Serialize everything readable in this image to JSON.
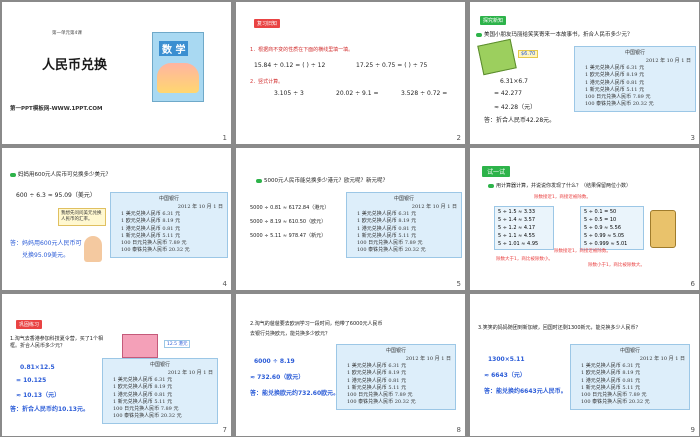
{
  "bank": {
    "title": "中国银行",
    "date": "2012 年 10 月 1 日",
    "rates": [
      "1 美元兑换人民币 6.31 元",
      "1 欧元兑换人民币 8.19 元",
      "1 港元兑换人民币 0.81 元",
      "1 新元兑换人民币 5.11 元",
      "100 日元兑换人民币 7.89 元",
      "100 泰铢兑换人民币 20.32 元"
    ]
  },
  "s1": {
    "small": "第一单元第4课",
    "title": "人民币兑换",
    "site": "第一PPT模板网-WWW.1PPT.COM",
    "book": "数 学",
    "page": "1"
  },
  "s2": {
    "tag": "复习旧知",
    "q1": "1．根据商不变的性质在下面的横线里填一填。",
    "e1": "15.84 ÷ 0.12 = (       ) ÷ 12",
    "e2": "17.25 ÷ 0.75 = (       ) ÷ 75",
    "q2": "2．竖式计算。",
    "c1": "3.105 ÷ 3",
    "c2": "20.02 ÷ 9.1 =",
    "c3": "3.528 ÷ 0.72 =",
    "page": "2"
  },
  "s3": {
    "tag": "探究新知",
    "q": "美国小朋友玛丽给笑笑寄来一本故事书，折合人民币多少元？",
    "price": "$6.70",
    "l1": "6.31×6.7",
    "l2": "= 42.277",
    "l3": "≈ 42.28（元）",
    "ans": "答：折合人民币42.28元。",
    "page": "3"
  },
  "s4": {
    "q": "妈妈用600元人民币可兑换多少美元？",
    "l1": "600 ÷ 6.3 ≈ 95.09（美元）",
    "bubble": "我想先问问美元兑换人民币的汇率。",
    "ans1": "答：妈妈用600元人民币可",
    "ans2": "兑换95.09美元。",
    "page": "4"
  },
  "s5": {
    "q": "5000元人民币能兑换多少港元？欧元呢？新元呢？",
    "l1": "5000 ÷ 0.81 ≈ 6172.84（港元）",
    "l2": "5000 ÷ 8.19 ≈ 610.50（欧元）",
    "l3": "5000 ÷ 5.11 ≈ 978.47（新元）",
    "page": "5"
  },
  "s6": {
    "tag": "试一试",
    "q": "用计算器计算，并说说你发现了什么？（结果保留两位小数）",
    "n1": "除数接近1，商接近被除数。",
    "left": [
      "5 ÷ 1.5 ≈ 3.33",
      "5 ÷ 1.4 ≈ 3.57",
      "5 ÷ 1.2 ≈ 4.17",
      "5 ÷ 1.1 ≈ 4.55",
      "5 ÷ 1.01 ≈ 4.95"
    ],
    "right": [
      "5 ÷ 0.1 = 50",
      "5 ÷ 0.5 = 10",
      "5 ÷ 0.9 ≈ 5.56",
      "5 ÷ 0.99 ≈ 5.05",
      "5 ÷ 0.999 ≈ 5.01"
    ],
    "n2": "除数大于1，商比被除数小。",
    "n3": "除数小于1，商比被除数大。",
    "n4": "除数接近1，商接近被除数。",
    "page": "6"
  },
  "s7": {
    "tag": "巩固练习",
    "q1": "1.淘气去香港参加科技夏令营，买了1个相框。折合人民币多少元？",
    "price": "12.5 港元",
    "l1": "0.81×12.5",
    "l2": "= 10.125",
    "l3": "≈ 10.13（元）",
    "ans": "答：折合人民币约10.13元。",
    "page": "7"
  },
  "s8": {
    "q1": "2.淘气的爸爸要去欧洲学习一段时间，他带了6000元人民币",
    "q2": "去银行兑换欧元，能兑换多少欧元？",
    "l1": "6000 ÷ 8.19",
    "l2": "≈ 732.60（欧元）",
    "ans": "答：能兑换欧元约732.60欧元。",
    "page": "8"
  },
  "s9": {
    "q": "3.笑笑的妈妈随团到新加坡，回国时还剩1300新元，能兑换多少人民币？",
    "l1": "1300×5.11",
    "l2": "≈ 6643（元）",
    "ans": "答：能兑换约6643元人民币。",
    "page": "9"
  }
}
